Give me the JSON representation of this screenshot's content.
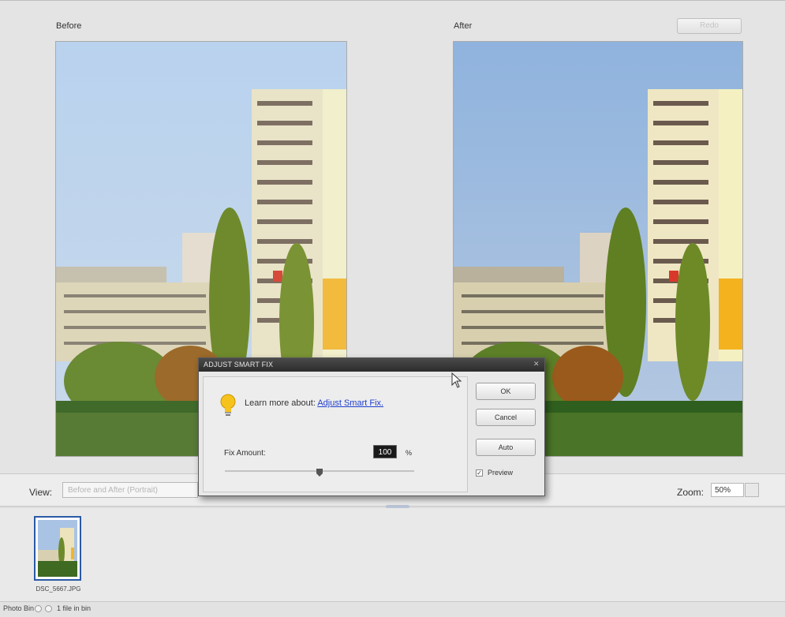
{
  "workspace": {
    "before_label": "Before",
    "after_label": "After",
    "redo_label": "Redo"
  },
  "view_bar": {
    "view_label": "View:",
    "view_selected": "Before and After (Portrait)",
    "zoom_label": "Zoom:",
    "zoom_value": "50%"
  },
  "photo_bin": {
    "thumbnail_name": "DSC_5667.JPG"
  },
  "status_bar": {
    "label": "Photo Bin",
    "file_count": "1 file in bin"
  },
  "dialog": {
    "title": "ADJUST SMART FIX",
    "learn_prefix": "Learn more about:",
    "learn_link": "Adjust Smart Fix.",
    "fix_amount_label": "Fix Amount:",
    "fix_amount_value": "100",
    "fix_amount_unit": "%",
    "fix_amount_fraction": 0.5,
    "ok_label": "OK",
    "cancel_label": "Cancel",
    "auto_label": "Auto",
    "preview_label": "Preview",
    "preview_checked": true
  },
  "colors": {
    "link": "#1f3fcf",
    "selection": "#2b5aa6",
    "dialog_titlebar": "#2c2c2c"
  }
}
